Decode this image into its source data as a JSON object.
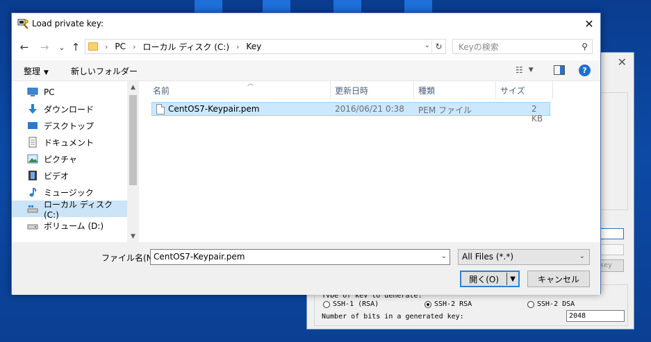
{
  "dialog": {
    "title": "Load private key:",
    "close_glyph": "✕"
  },
  "nav": {
    "back_glyph": "←",
    "forward_glyph": "→",
    "recent_glyph": "⌄",
    "up_glyph": "↑",
    "breadcrumb": [
      "PC",
      "ローカル ディスク (C:)",
      "Key"
    ],
    "breadcrumb_sep": "›",
    "search_placeholder": "Keyの検索"
  },
  "toolbar": {
    "organize_label": "整理",
    "new_folder_label": "新しいフォルダー"
  },
  "sidebar": {
    "items": [
      {
        "label": "PC",
        "icon": "pc-icon"
      },
      {
        "label": "ダウンロード",
        "icon": "download-icon"
      },
      {
        "label": "デスクトップ",
        "icon": "desktop-icon"
      },
      {
        "label": "ドキュメント",
        "icon": "document-icon"
      },
      {
        "label": "ピクチャ",
        "icon": "picture-icon"
      },
      {
        "label": "ビデオ",
        "icon": "video-icon"
      },
      {
        "label": "ミュージック",
        "icon": "music-icon"
      },
      {
        "label": "ローカル ディスク (C:)",
        "icon": "drive-icon",
        "selected": true
      },
      {
        "label": "ボリューム (D:)",
        "icon": "drive-icon"
      }
    ]
  },
  "file_list": {
    "columns": [
      "名前",
      "更新日時",
      "種類",
      "サイズ"
    ],
    "rows": [
      {
        "name": "CentOS7-Keypair.pem",
        "modified": "2016/06/21 0:38",
        "type": "PEM ファイル",
        "size": "2 KB",
        "selected": true
      }
    ]
  },
  "footer": {
    "filename_label": "ファイル名(N):",
    "filename_value": "CentOS7-Keypair.pem",
    "filter_value": "All Files (*.*)",
    "open_label": "開く(O)",
    "cancel_label": "キャンセル"
  },
  "background_window": {
    "key_button_label": "key",
    "type_label": "Type of key to generate:",
    "radio_options": [
      {
        "label": "SSH-1 (RSA)",
        "checked": false
      },
      {
        "label": "SSH-2 RSA",
        "checked": true
      },
      {
        "label": "SSH-2 DSA",
        "checked": false
      }
    ],
    "bits_label": "Number of bits in a generated key:",
    "bits_value": "2048"
  },
  "colors": {
    "accent": "#2b7fd8",
    "selection": "#cce8ff",
    "nav_selection": "#cce4f7"
  }
}
